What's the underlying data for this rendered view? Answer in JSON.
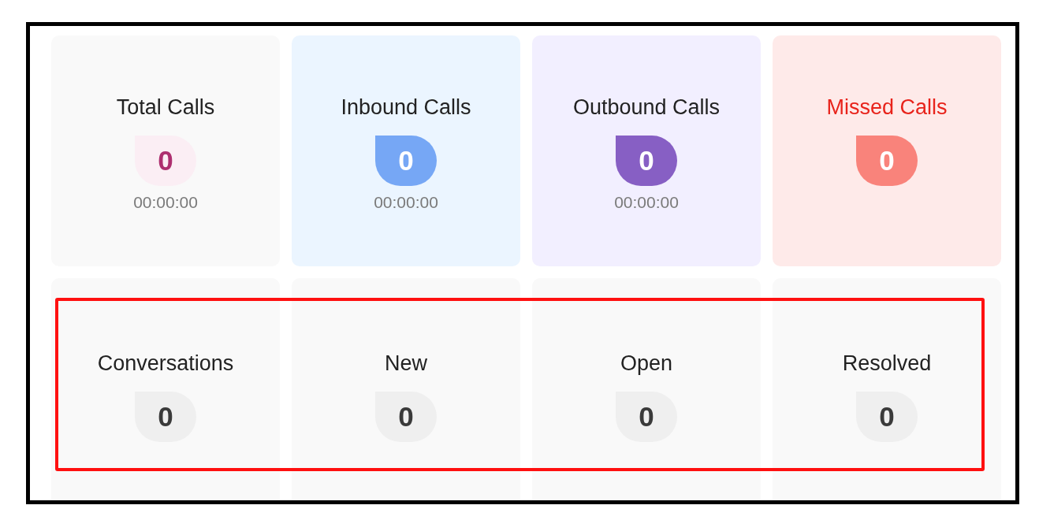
{
  "call_stats": [
    {
      "title": "Total Calls",
      "count": "0",
      "duration": "00:00:00",
      "kind": "total",
      "color": "#fbeef4"
    },
    {
      "title": "Inbound Calls",
      "count": "0",
      "duration": "00:00:00",
      "kind": "inbound",
      "color": "#76a7f5"
    },
    {
      "title": "Outbound Calls",
      "count": "0",
      "duration": "00:00:00",
      "kind": "outbound",
      "color": "#875fc4"
    },
    {
      "title": "Missed Calls",
      "count": "0",
      "kind": "missed",
      "color": "#f9837b"
    }
  ],
  "conversation_stats": [
    {
      "title": "Conversations",
      "count": "0",
      "color": "#efefef"
    },
    {
      "title": "New",
      "count": "0",
      "color": "#efefef"
    },
    {
      "title": "Open",
      "count": "0",
      "color": "#efefef"
    },
    {
      "title": "Resolved",
      "count": "0",
      "color": "#efefef"
    }
  ]
}
